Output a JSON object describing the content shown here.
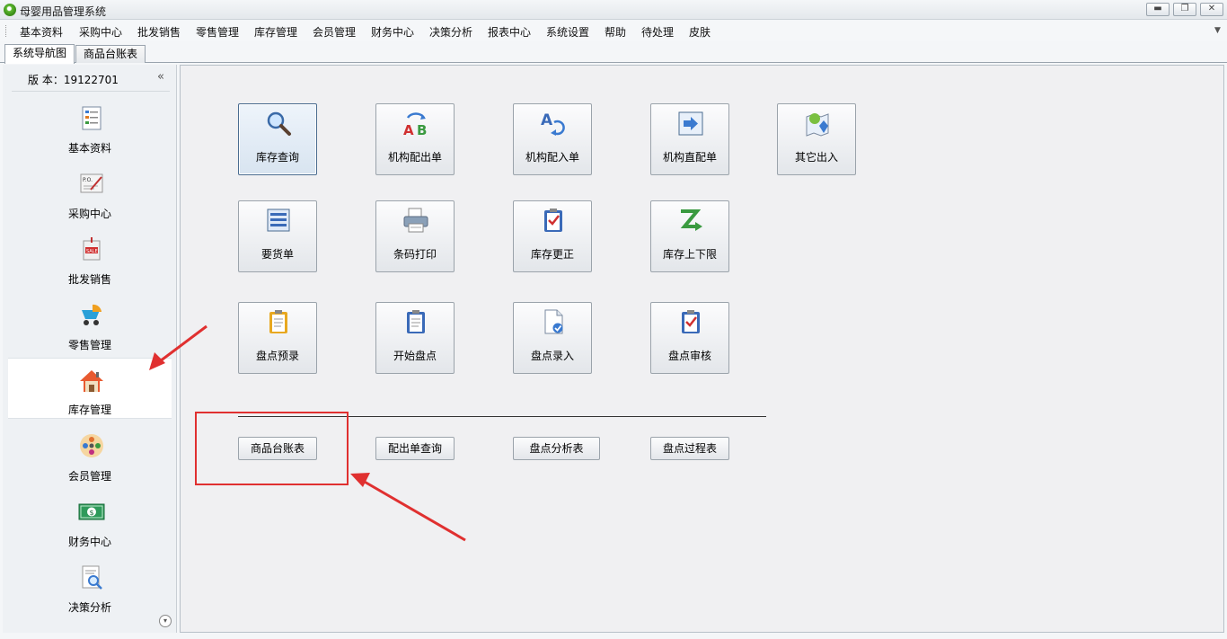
{
  "window": {
    "title": "母婴用品管理系统",
    "minimize": "▬",
    "maximize": "❐",
    "close": "✕"
  },
  "menu": [
    "基本资料",
    "采购中心",
    "批发销售",
    "零售管理",
    "库存管理",
    "会员管理",
    "财务中心",
    "决策分析",
    "报表中心",
    "系统设置",
    "帮助",
    "待处理",
    "皮肤"
  ],
  "tabs": [
    "系统导航图",
    "商品台账表"
  ],
  "sidebar": {
    "version": "版 本：19122701",
    "collapse": "«",
    "items": [
      {
        "label": "基本资料",
        "icon": "document-list-icon"
      },
      {
        "label": "采购中心",
        "icon": "purchase-order-icon"
      },
      {
        "label": "批发销售",
        "icon": "sale-bag-icon"
      },
      {
        "label": "零售管理",
        "icon": "stroller-icon"
      },
      {
        "label": "库存管理",
        "icon": "house-icon",
        "active": true
      },
      {
        "label": "会员管理",
        "icon": "members-icon"
      },
      {
        "label": "财务中心",
        "icon": "money-icon"
      },
      {
        "label": "决策分析",
        "icon": "analysis-icon"
      }
    ],
    "scroll_down": "▾"
  },
  "tiles": [
    {
      "label": "库存查询",
      "icon": "magnifier-icon",
      "selected": true
    },
    {
      "label": "机构配出单",
      "icon": "ab-swap-icon"
    },
    {
      "label": "机构配入单",
      "icon": "a-return-icon"
    },
    {
      "label": "机构直配单",
      "icon": "export-icon"
    },
    {
      "label": "其它出入",
      "icon": "map-pin-icon"
    },
    {
      "label": "要货单",
      "icon": "form-list-icon"
    },
    {
      "label": "条码打印",
      "icon": "printer-icon"
    },
    {
      "label": "库存更正",
      "icon": "clipboard-check-icon"
    },
    {
      "label": "库存上下限",
      "icon": "z-arrow-icon"
    },
    {
      "label": "盘点预录",
      "icon": "clipboard-yellow-icon"
    },
    {
      "label": "开始盘点",
      "icon": "clipboard-blue-icon"
    },
    {
      "label": "盘点录入",
      "icon": "document-check-icon"
    },
    {
      "label": "盘点审核",
      "icon": "clipboard-audit-icon"
    }
  ],
  "report_buttons": [
    "商品台账表",
    "配出单查询",
    "盘点分析表",
    "盘点过程表"
  ],
  "colors": {
    "highlight": "#e03030",
    "selected_border": "#4a6c90"
  }
}
